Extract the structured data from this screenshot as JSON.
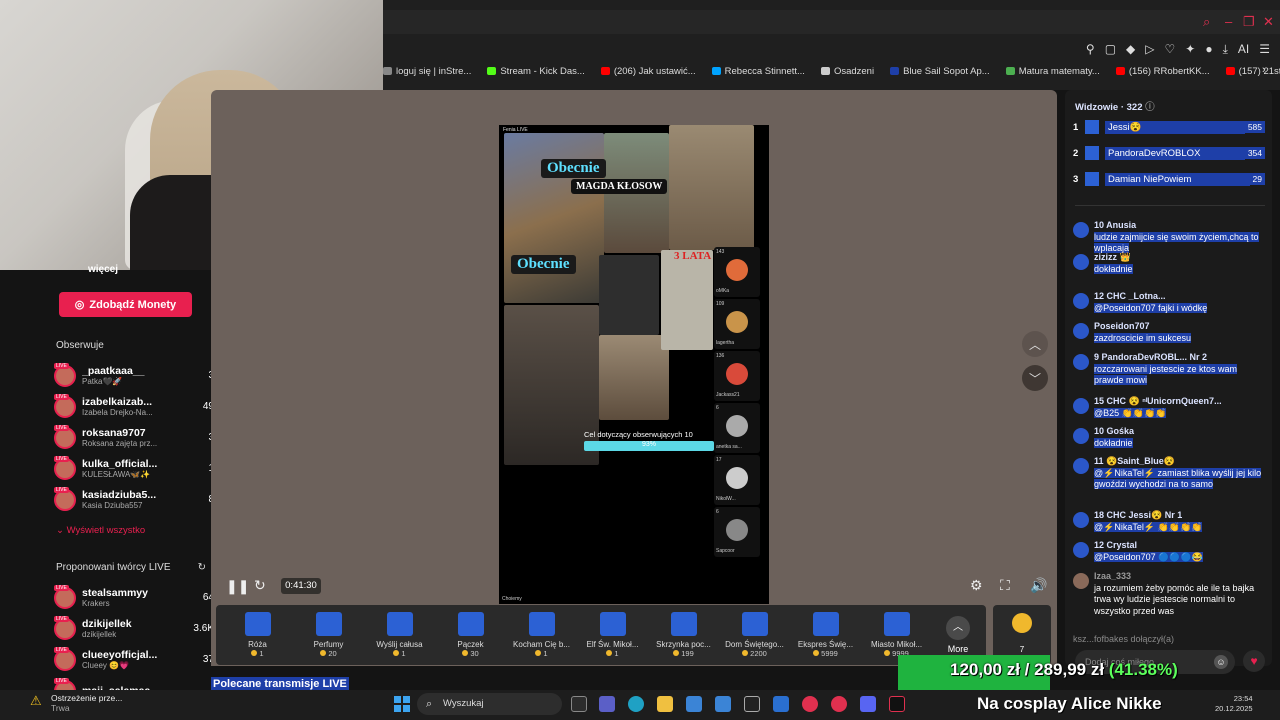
{
  "browser": {
    "bookmarks": [
      {
        "label": "loguj się | inStre...",
        "color": "#888888"
      },
      {
        "label": "Stream - Kick Das...",
        "color": "#53fc18"
      },
      {
        "label": "(206) Jak ustawić...",
        "color": "#ff0000"
      },
      {
        "label": "Rebecca Stinnett...",
        "color": "#00a3ff"
      },
      {
        "label": "Osadzeni",
        "color": "#cccccc"
      },
      {
        "label": "Blue Sail Sopot Ap...",
        "color": "#1e3fa8"
      },
      {
        "label": "Matura matematy...",
        "color": "#4caf50"
      },
      {
        "label": "(156) RRobertKK...",
        "color": "#ff0000"
      },
      {
        "label": "(157) 21st Century...",
        "color": "#ff0000"
      }
    ],
    "ai_label": "AI"
  },
  "sidebar": {
    "partial_label": "więcej",
    "coins_button": "Zdobądź Monety",
    "following_title": "Obserwuje",
    "following": [
      {
        "name": "_paatkaaa__",
        "sub": "Patka🖤🚀",
        "count": "3"
      },
      {
        "name": "izabelkaizab...",
        "sub": "Izabela Drejko-Na...",
        "count": "49"
      },
      {
        "name": "roksana9707",
        "sub": "Roksana zajęta prz...",
        "count": "3"
      },
      {
        "name": "kulka_official...",
        "sub": "KULESŁAWA🦋✨",
        "count": "1"
      },
      {
        "name": "kasiadziuba5...",
        "sub": "Kasia Dziuba557",
        "count": "8"
      }
    ],
    "show_all": "Wyświetl wszystko",
    "suggested_title": "Proponowani twórcy LIVE",
    "suggested": [
      {
        "name": "stealsammyy",
        "sub": "Krakers",
        "count": "64"
      },
      {
        "name": "dzikijellek",
        "sub": "dzikijellek",
        "count": "3.6K"
      },
      {
        "name": "clueeyofficjal...",
        "sub": "Clueey 😊💗",
        "count": "37"
      },
      {
        "name": "maji_salamaa",
        "sub": "",
        "count": ""
      }
    ],
    "live_badge": "LIVE"
  },
  "video": {
    "top_label": "Fenia LIVE",
    "obecnie_1": "Obecnie",
    "name_1": "MAGDA KŁOSOW",
    "obecnie_2": "Obecnie",
    "small_text": "3 LATA",
    "goal_text": "Cel dotyczący obserwujących 10",
    "goal_percent": "93%",
    "goal_value": 0.93,
    "bottom_label": "Choiemy",
    "viewers": [
      {
        "count": "143",
        "name": "oMKa",
        "color": "#e06b3a"
      },
      {
        "count": "109",
        "name": "lagertha",
        "color": "#c9944a"
      },
      {
        "count": "136",
        "name": "Jackass21",
        "color": "#d94a3a"
      },
      {
        "count": "6",
        "name": "anetka sa...",
        "color": "#aaaaaa"
      },
      {
        "count": "17",
        "name": "NikolW...",
        "color": "#cccccc"
      },
      {
        "count": "6",
        "name": "Sapcoor",
        "color": "#888888"
      }
    ],
    "timecode": "0:41:30"
  },
  "gifts": [
    {
      "name": "Róża",
      "price": "1"
    },
    {
      "name": "Perfumy",
      "price": "20"
    },
    {
      "name": "Wyślij całusa",
      "price": "1"
    },
    {
      "name": "Pączek",
      "price": "30"
    },
    {
      "name": "Kocham Cię b...",
      "price": "1"
    },
    {
      "name": "Elf Św. Mikoł...",
      "price": "1"
    },
    {
      "name": "Skrzynka poc...",
      "price": "199"
    },
    {
      "name": "Dom Świętego...",
      "price": "2200"
    },
    {
      "name": "Ekspres Świę...",
      "price": "5999"
    },
    {
      "name": "Miasto Mikoł...",
      "price": "9999"
    }
  ],
  "gifts_more": "More",
  "gifts_coin_count": "7",
  "chat": {
    "viewers_title": "Widzowie · 322",
    "ranking": [
      {
        "rank": "1",
        "name": "Jessi😵",
        "count": "585"
      },
      {
        "rank": "2",
        "name": "PandoraDevROBLOX",
        "count": "354"
      },
      {
        "rank": "3",
        "name": "Damian NiePowiem",
        "count": "29"
      }
    ],
    "messages": [
      {
        "user": "10 Anusia",
        "text": "ludzie zajmijcie się swoim życiem,chcą to wplacaja"
      },
      {
        "user": "zizizz 👑",
        "text": "dokładnie"
      },
      {
        "user": "12 CHC _Lotna...",
        "text": "@Poseidon707 fajki i wódkę"
      },
      {
        "user": "Poseidon707",
        "text": "zazdroscicie im sukcesu"
      },
      {
        "user": "9 PandoraDevROBL... Nr 2",
        "text": "rozczarowani jestescie ze ktos wam prawde mowi"
      },
      {
        "user": "15 CHC 😵 ⁿˡUnicornQueen7...",
        "text": "@B25 👏👏👏👏"
      },
      {
        "user": "10 Gośka",
        "text": "dokładnie"
      },
      {
        "user": "11 😵Saint_Blue😵",
        "text": "@⚡NikaTel⚡ zamiast blika wyślij jej kilo gwoździ wychodzi na to samo"
      },
      {
        "user": "18 CHC Jessi😵 Nr 1",
        "text": "@⚡NikaTel⚡ 👏👏👏👏"
      },
      {
        "user": "12 Crystal",
        "text": "@Poseidon707 🔵🔵🔵😂"
      },
      {
        "user": "Izaa_333",
        "text": "ja rozumiem żeby pomóc ale ile ta bajka trwa wy ludzie jestescie normalni to wszystko przed was"
      }
    ],
    "join_notice": "ksz...fofbakes dołączył(a)",
    "input_placeholder": "Dodaj coś miłego..."
  },
  "overlay": {
    "donation": "120,00 zł / 289,99 zł",
    "donation_pct": "(41.38%)",
    "cosplay": "Na cosplay Alice Nikke",
    "promo": "Polecane transmisje LIVE"
  },
  "taskbar": {
    "warning_title": "Ostrzeżenie prze...",
    "warning_sub": "Trwa",
    "search": "Wyszukaj",
    "time": "23:54",
    "date": "20.12.2025"
  },
  "accent": "#e8204f",
  "highlight": "#1e3fa8"
}
